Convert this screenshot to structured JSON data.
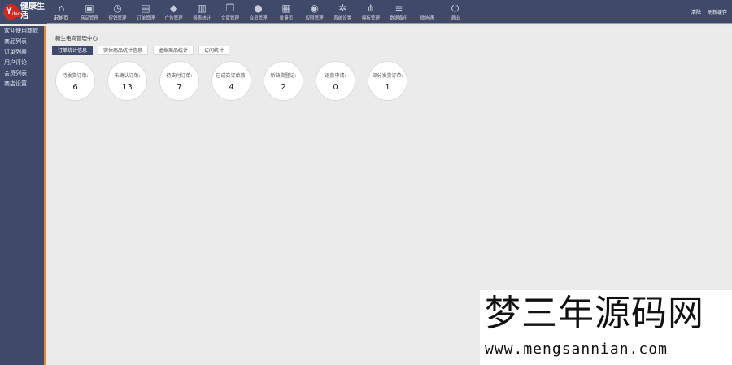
{
  "logo": {
    "mark_letter": "Y",
    "mark_small": "dao",
    "text": "健康生活"
  },
  "nav": [
    {
      "label": "起始页",
      "icon": "home-icon",
      "glyph": "⌂"
    },
    {
      "label": "商品管理",
      "icon": "image-icon",
      "glyph": "▣"
    },
    {
      "label": "促销管理",
      "icon": "clock-icon",
      "glyph": "◷"
    },
    {
      "label": "订单管理",
      "icon": "document-icon",
      "glyph": "▤"
    },
    {
      "label": "广告管理",
      "icon": "paint-bucket-icon",
      "glyph": "◆"
    },
    {
      "label": "报表统计",
      "icon": "bar-chart-icon",
      "glyph": "▥"
    },
    {
      "label": "文章管理",
      "icon": "copy-icon",
      "glyph": "❐"
    },
    {
      "label": "会员管理",
      "icon": "user-icon",
      "glyph": "●"
    },
    {
      "label": "批量页",
      "icon": "building-icon",
      "glyph": "▦"
    },
    {
      "label": "权限管理",
      "icon": "users-icon",
      "glyph": "◉"
    },
    {
      "label": "系统设置",
      "icon": "gear-icon",
      "glyph": "✲"
    },
    {
      "label": "模板管理",
      "icon": "share-icon",
      "glyph": "⋔"
    },
    {
      "label": "数据备份",
      "icon": "database-icon",
      "glyph": "≡"
    },
    {
      "label": "微信通",
      "icon": "wechat-icon",
      "glyph": " "
    },
    {
      "label": "退出",
      "icon": "power-icon",
      "glyph": "⏻"
    }
  ],
  "top_right": {
    "link1": "清除",
    "link2": "刷新缓存"
  },
  "sidebar": [
    "欢迎使用商城",
    "商品列表",
    "订单列表",
    "用户评论",
    "会员列表",
    "商店设置"
  ],
  "page_title": "新生电商管理中心",
  "tabs": [
    {
      "label": "订单统计信息",
      "active": true
    },
    {
      "label": "实体商品统计信息",
      "active": false
    },
    {
      "label": "虚拟商品统计",
      "active": false
    },
    {
      "label": "访问统计",
      "active": false
    }
  ],
  "stats": [
    {
      "label": "待发货订单:",
      "value": "6"
    },
    {
      "label": "未确认订单:",
      "value": "13"
    },
    {
      "label": "待支付订单:",
      "value": "7"
    },
    {
      "label": "已成交订单数:",
      "value": "4"
    },
    {
      "label": "新缺货登记:",
      "value": "2"
    },
    {
      "label": "退款申请:",
      "value": "0"
    },
    {
      "label": "部分发货订单:",
      "value": "1"
    }
  ],
  "watermark": {
    "title": "梦三年源码网",
    "url": "www.mengsannian.com"
  },
  "colors": {
    "topbar": "#3f4a6b",
    "accent": "#f08a24",
    "logo_red": "#d8261c"
  }
}
